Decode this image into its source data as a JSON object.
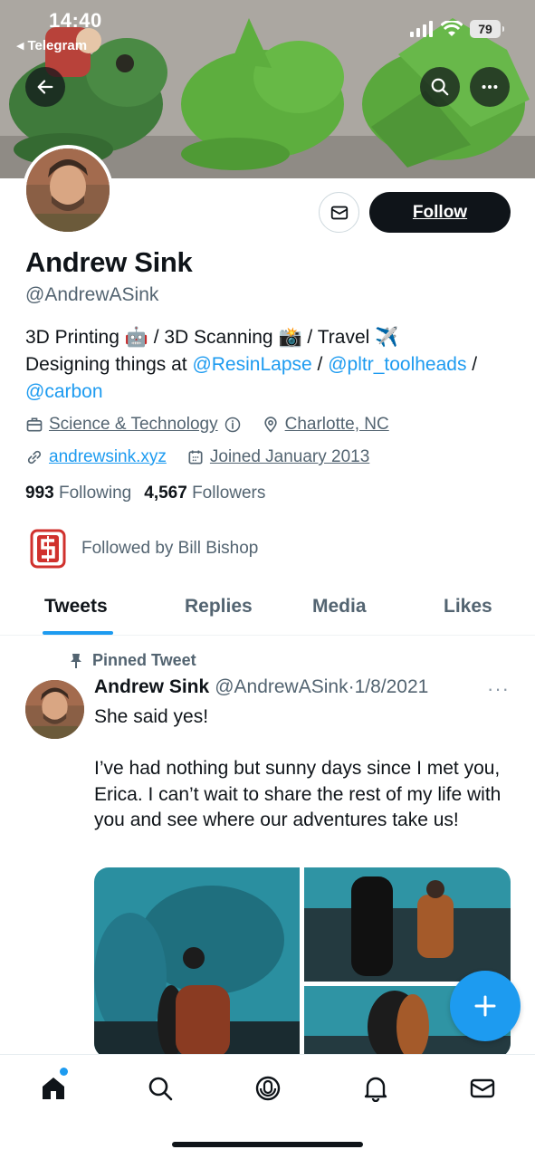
{
  "status_bar": {
    "time": "14:40",
    "back_app": "Telegram",
    "battery": "79"
  },
  "header": {
    "back_icon": "arrow-left-icon",
    "search_icon": "search-icon",
    "more_icon": "more-horizontal-icon"
  },
  "profile": {
    "name": "Andrew Sink",
    "handle": "@AndrewASink",
    "follow_label": "Follow",
    "bio": {
      "line1_a": "3D Printing 🤖 / 3D Scanning 📸 / Travel ✈️",
      "line2_a": "Designing things at ",
      "mention1": "@ResinLapse",
      "sep1": " / ",
      "mention2": "@pltr_toolheads",
      "sep2": " /",
      "mention3": "@carbon"
    },
    "category": "Science & Technology",
    "location": "Charlotte, NC",
    "website": "andrewsink.xyz",
    "joined": "Joined January 2013",
    "following_count": "993",
    "following_label": "Following",
    "followers_count": "4,567",
    "followers_label": "Followers",
    "followed_by": "Followed by Bill Bishop"
  },
  "tabs": [
    {
      "label": "Tweets",
      "active": true
    },
    {
      "label": "Replies",
      "active": false
    },
    {
      "label": "Media",
      "active": false
    },
    {
      "label": "Likes",
      "active": false
    }
  ],
  "tweet": {
    "pinned_label": "Pinned Tweet",
    "author_name": "Andrew Sink",
    "author_handle": "@AndrewASink",
    "separator": "·",
    "date": "1/8/2021",
    "more": "···",
    "text": "She said yes!\n\nI’ve had nothing but sunny days since I met you, Erica. I can’t wait to share the rest of my life with you and see where our adventures take us!"
  },
  "colors": {
    "accent": "#1d9bf0",
    "text_primary": "#0f1419",
    "text_secondary": "#536471",
    "follow_bg": "#0f1419"
  },
  "bottom_nav": [
    "home-icon",
    "search-icon",
    "spaces-icon",
    "notifications-icon",
    "messages-icon"
  ]
}
